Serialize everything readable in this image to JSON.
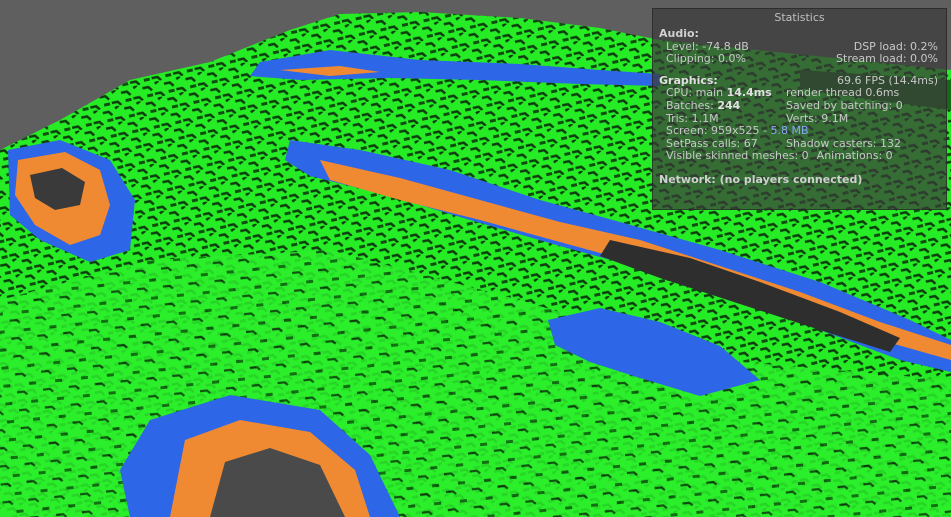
{
  "statistics": {
    "title": "Statistics",
    "audio": {
      "header": "Audio:",
      "level_label": "Level:",
      "level_value": "-74.8 dB",
      "dsp_label": "DSP load:",
      "dsp_value": "0.2%",
      "clipping_label": "Clipping:",
      "clipping_value": "0.0%",
      "stream_label": "Stream load:",
      "stream_value": "0.0%"
    },
    "graphics": {
      "header": "Graphics:",
      "fps": "69.6 FPS (14.4ms)",
      "cpu_label": "CPU: main",
      "cpu_main": "14.4ms",
      "render_thread": "render thread 0.6ms",
      "batches_label": "Batches:",
      "batches": "244",
      "saved_by_batching": "Saved by batching: 0",
      "tris": "Tris: 1.1M",
      "verts": "Verts: 9.1M",
      "screen_label": "Screen: 959x525 -",
      "screen_mem": "5.8 MB",
      "setpass": "SetPass calls: 67",
      "shadow_casters": "Shadow casters: 132",
      "skinned_meshes": "Visible skinned meshes: 0",
      "animations": "Animations: 0"
    },
    "network": {
      "header": "Network: (no players connected)"
    }
  },
  "colors": {
    "grass": "#22ee22",
    "grass_dark": "#149a14",
    "water": "#2d66e6",
    "sand": "#f08a32",
    "rock": "#3a3a3a",
    "sky": "#5f5f5f"
  }
}
